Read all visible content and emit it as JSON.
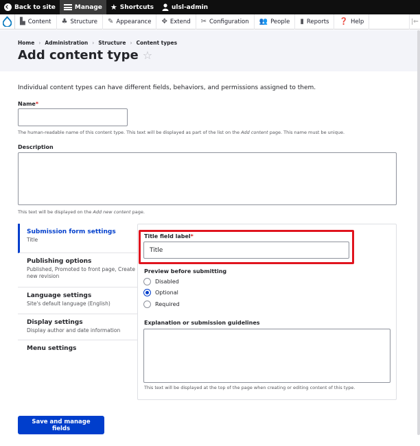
{
  "toolbar": {
    "back": "Back to site",
    "manage": "Manage",
    "shortcuts": "Shortcuts",
    "user": "ulsl-admin"
  },
  "tray": {
    "content": "Content",
    "structure": "Structure",
    "appearance": "Appearance",
    "extend": "Extend",
    "configuration": "Configuration",
    "people": "People",
    "reports": "Reports",
    "help": "Help"
  },
  "breadcrumb": [
    "Home",
    "Administration",
    "Structure",
    "Content types"
  ],
  "page": {
    "title": "Add content type",
    "intro": "Individual content types can have different fields, behaviors, and permissions assigned to them."
  },
  "name_field": {
    "label": "Name",
    "value": "",
    "help_before": "The human-readable name of this content type. This text will be displayed as part of the list on the ",
    "help_em": "Add content",
    "help_after": " page. This name must be unique."
  },
  "description_field": {
    "label": "Description",
    "help_before": "This text will be displayed on the ",
    "help_em": "Add new content",
    "help_after": " page."
  },
  "vtabs": [
    {
      "title": "Submission form settings",
      "summary": "Title"
    },
    {
      "title": "Publishing options",
      "summary": "Published, Promoted to front page, Create new revision"
    },
    {
      "title": "Language settings",
      "summary": "Site's default language (English)"
    },
    {
      "title": "Display settings",
      "summary": "Display author and date information"
    },
    {
      "title": "Menu settings",
      "summary": ""
    }
  ],
  "submission": {
    "title_label": "Title field label",
    "title_value": "Title",
    "preview_label": "Preview before submitting",
    "options": [
      "Disabled",
      "Optional",
      "Required"
    ],
    "selected": "Optional",
    "guidelines_label": "Explanation or submission guidelines",
    "guidelines_help": "This text will be displayed at the top of the page when creating or editing content of this type."
  },
  "save_label": "Save and manage fields",
  "colors": {
    "accent": "#003ecc",
    "highlight": "#e0141e"
  }
}
